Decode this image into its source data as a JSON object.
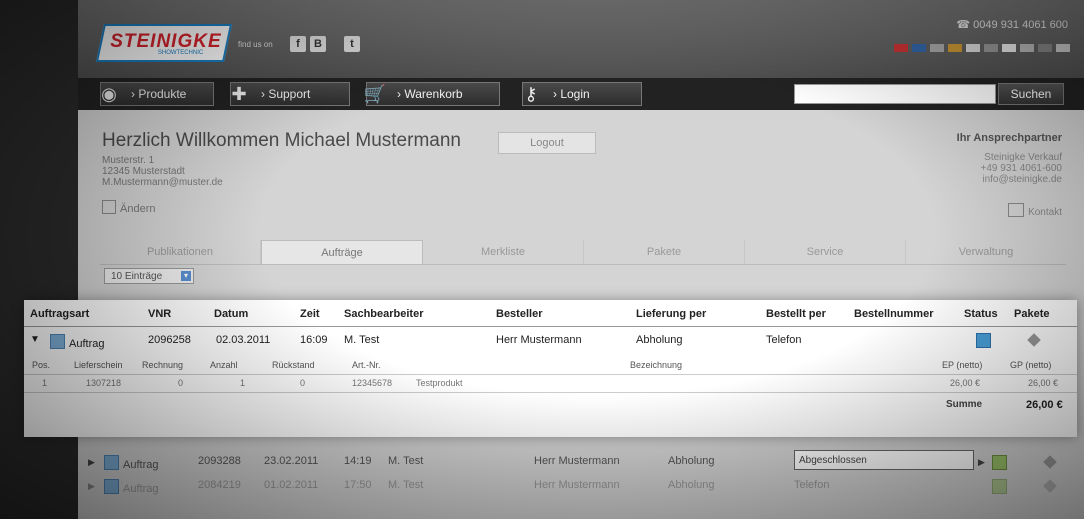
{
  "header": {
    "logo_text": "STEINIGKE",
    "logo_sub": "SHOWTECHNIC",
    "social_label": "find us on",
    "social_icons": [
      "f",
      "B",
      "t"
    ],
    "phone": "0049 931 4061 600"
  },
  "nav": {
    "items": [
      {
        "label": "› Produkte",
        "icon": "globe-icon"
      },
      {
        "label": "› Support",
        "icon": "plus-icon"
      },
      {
        "label": "› Warenkorb",
        "icon": "cart-icon"
      },
      {
        "label": "› Login",
        "icon": "key-icon"
      }
    ],
    "search_placeholder": "",
    "search_label": "Suchen"
  },
  "account": {
    "welcome": "Herzlich Willkommen Michael Mustermann",
    "logout": "Logout",
    "address": [
      "Musterstr. 1",
      "12345 Musterstadt",
      "M.Mustermann@muster.de"
    ],
    "edit": "Ändern"
  },
  "contact": {
    "title": "Ihr Ansprechpartner",
    "lines": [
      "Steinigke Verkauf",
      "+49 931 4061-600",
      "info@steinigke.de"
    ],
    "button": "Kontakt"
  },
  "tabs": [
    "Publikationen",
    "Aufträge",
    "Merkliste",
    "Pakete",
    "Service",
    "Verwaltung"
  ],
  "entries_select": "10 Einträge",
  "orders": {
    "headers": [
      "Auftragsart",
      "VNR",
      "Datum",
      "Zeit",
      "Sachbearbeiter",
      "Besteller",
      "Lieferung per",
      "Bestellt per",
      "Bestellnummer",
      "Status",
      "Pakete"
    ],
    "expanded": {
      "art": "Auftrag",
      "vnr": "2096258",
      "datum": "02.03.2011",
      "zeit": "16:09",
      "sachbearbeiter": "M. Test",
      "besteller": "Herr Mustermann",
      "lieferung": "Abholung",
      "bestellt": "Telefon"
    },
    "sub_headers": [
      "Pos.",
      "Lieferschein",
      "Rechnung",
      "Anzahl",
      "Rückstand",
      "Art.-Nr.",
      "Bezeichnung",
      "EP (netto)",
      "GP (netto)"
    ],
    "sub_row": [
      "1",
      "1307218",
      "0",
      "1",
      "0",
      "12345678",
      "Testprodukt",
      "26,00 €",
      "26,00 €"
    ],
    "sum_label": "Summe",
    "sum_value": "26,00 €",
    "rows": [
      {
        "art": "Auftrag",
        "vnr": "2093288",
        "datum": "23.02.2011",
        "zeit": "14:19",
        "sachbearbeiter": "M. Test",
        "besteller": "Herr Mustermann",
        "lieferung": "Abholung"
      },
      {
        "art": "Auftrag",
        "vnr": "2084219",
        "datum": "01.02.2011",
        "zeit": "17:50",
        "sachbearbeiter": "M. Test",
        "besteller": "Herr Mustermann",
        "lieferung": "Abholung",
        "bestellt": "Telefon"
      }
    ],
    "status_popup": "Abgeschlossen"
  }
}
